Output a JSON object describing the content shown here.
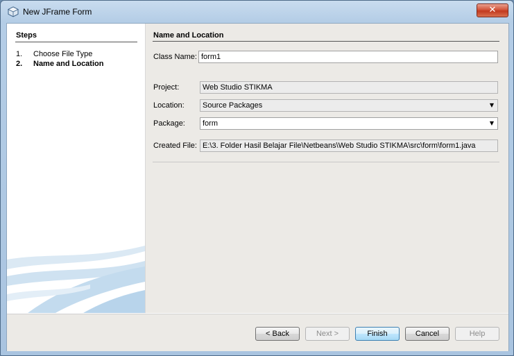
{
  "window": {
    "title": "New JFrame Form",
    "close_symbol": "✕"
  },
  "steps": {
    "title": "Steps",
    "items": [
      {
        "num": "1.",
        "label": "Choose File Type"
      },
      {
        "num": "2.",
        "label": "Name and Location"
      }
    ]
  },
  "panel": {
    "title": "Name and Location",
    "class_name": {
      "label": "Class Name:",
      "value": "form1"
    },
    "project": {
      "label": "Project:",
      "value": "Web Studio STIKMA"
    },
    "location": {
      "label": "Location:",
      "value": "Source Packages"
    },
    "package": {
      "label": "Package:",
      "value": "form"
    },
    "created_file": {
      "label": "Created File:",
      "value": "E:\\3. Folder Hasil Belajar File\\Netbeans\\Web Studio STIKMA\\src\\form\\form1.java"
    }
  },
  "buttons": {
    "back": "< Back",
    "next": "Next >",
    "finish": "Finish",
    "cancel": "Cancel",
    "help": "Help"
  },
  "icons": {
    "app": "netbeans-cube-icon",
    "dropdown": "chevron-down-icon"
  },
  "colors": {
    "accent": "#3c7fb1",
    "close": "#c23a1f"
  }
}
